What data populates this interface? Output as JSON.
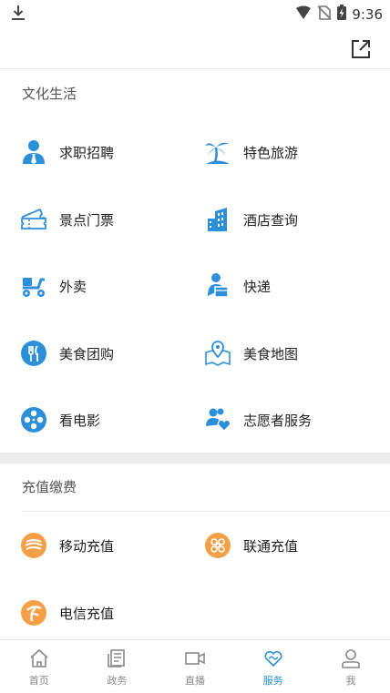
{
  "status_bar": {
    "time": "9:36"
  },
  "sections": [
    {
      "title": "文化生活",
      "items": [
        {
          "label": "求职招聘",
          "icon": "person-job-icon"
        },
        {
          "label": "特色旅游",
          "icon": "palm-tree-icon"
        },
        {
          "label": "景点门票",
          "icon": "ticket-icon"
        },
        {
          "label": "酒店查询",
          "icon": "hotel-building-icon"
        },
        {
          "label": "外卖",
          "icon": "scooter-icon"
        },
        {
          "label": "快递",
          "icon": "courier-icon"
        },
        {
          "label": "美食团购",
          "icon": "fork-knife-icon"
        },
        {
          "label": "美食地图",
          "icon": "map-pin-icon"
        },
        {
          "label": "看电影",
          "icon": "film-reel-icon"
        },
        {
          "label": "志愿者服务",
          "icon": "volunteer-heart-icon"
        }
      ]
    },
    {
      "title": "充值缴费",
      "items": [
        {
          "label": "移动充值",
          "icon": "china-mobile-icon"
        },
        {
          "label": "联通充值",
          "icon": "china-unicom-icon"
        },
        {
          "label": "电信充值",
          "icon": "china-telecom-icon"
        }
      ]
    }
  ],
  "bottom_nav": [
    {
      "label": "首页",
      "icon": "home-icon",
      "active": false
    },
    {
      "label": "政务",
      "icon": "document-icon",
      "active": false
    },
    {
      "label": "直播",
      "icon": "video-camera-icon",
      "active": false
    },
    {
      "label": "服务",
      "icon": "heart-handshake-icon",
      "active": true
    },
    {
      "label": "我",
      "icon": "user-icon",
      "active": false
    }
  ],
  "colors": {
    "accent": "#2d8fd9",
    "orange": "#f5a048",
    "divider": "#ececec"
  }
}
